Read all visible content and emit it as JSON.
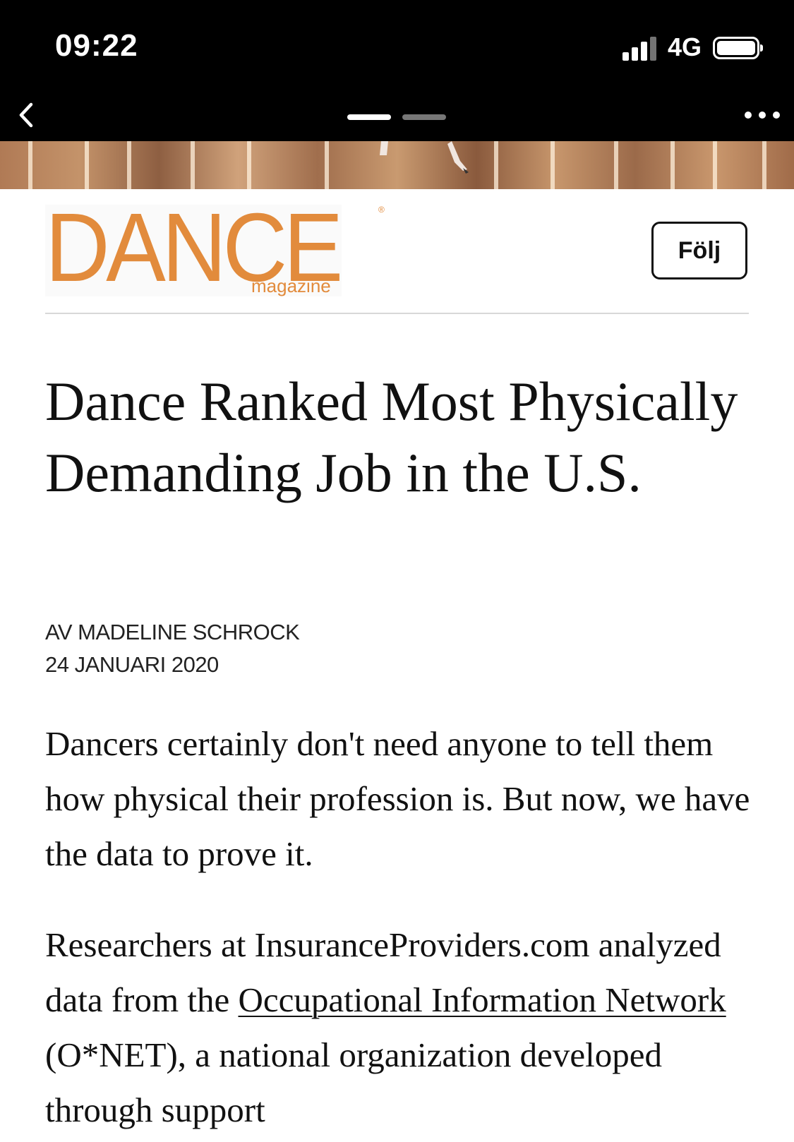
{
  "status_bar": {
    "time": "09:22",
    "network": "4G"
  },
  "nav": {
    "back_icon": "chevron-left-icon",
    "more_icon": "ellipsis-icon"
  },
  "publication": {
    "logo_word": "DANCE",
    "logo_sub": "magazine",
    "logo_mark": "®",
    "follow_label": "Följ"
  },
  "article": {
    "title": "Dance Ranked Most Physically Demanding Job in the U.S.",
    "byline": "AV MADELINE SCHROCK",
    "date": "24 JANUARI 2020",
    "para1": "Dancers certainly don't need anyone to tell them how physical their profession is. But now, we have the data to prove it.",
    "para2_before": "Researchers at InsuranceProviders.com analyzed data from the ",
    "para2_link": "Occupational Information Network",
    "para2_after": " (O*NET), a national organization developed through support"
  },
  "colors": {
    "brand": "#e28b3c",
    "bar_bg": "#000000"
  }
}
